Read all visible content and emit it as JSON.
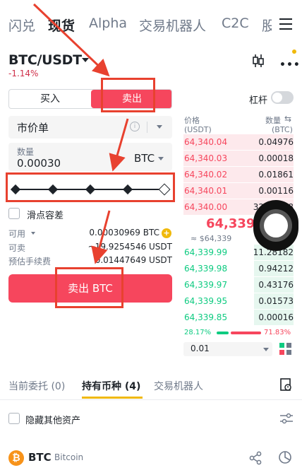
{
  "top_tabs": [
    {
      "label": "闪兑"
    },
    {
      "label": "现货"
    },
    {
      "label": "Alpha"
    },
    {
      "label": "交易机器人"
    },
    {
      "label": "C2C"
    },
    {
      "label": "股"
    }
  ],
  "pair": {
    "symbol": "BTC/USDT",
    "change": "-1.14%"
  },
  "trade_side": {
    "buy": "买入",
    "sell": "卖出"
  },
  "leverage": {
    "label": "杠杆",
    "enabled": false
  },
  "order_type": {
    "label": "市价单"
  },
  "amount": {
    "label": "数量",
    "value": "0.00030",
    "unit": "BTC"
  },
  "slider": {
    "percent": 100
  },
  "slippage": {
    "label": "滑点容差",
    "checked": false
  },
  "info": {
    "available_label": "可用",
    "available_value": "0.00030969 BTC",
    "sellable_label": "可卖",
    "sellable_value": "~19.9254546 USDT",
    "fee_label": "预估手续费",
    "fee_value": "0.01447649 USDT"
  },
  "sell_button": {
    "label": "卖出 BTC"
  },
  "order_book": {
    "price_header": "价格",
    "price_unit": "(USDT)",
    "qty_header": "数量",
    "qty_unit": "(BTC)",
    "asks": [
      {
        "price": "64,340.04",
        "qty": "0.04976"
      },
      {
        "price": "64,340.03",
        "qty": "0.00018"
      },
      {
        "price": "64,340.02",
        "qty": "0.01861"
      },
      {
        "price": "64,340.01",
        "qty": "0.00116"
      },
      {
        "price": "64,340.00",
        "qty": "32.00418"
      }
    ],
    "last_price": "64,339",
    "last_usd": "≈ $64,339",
    "bids": [
      {
        "price": "64,339.99",
        "qty": "11.28182"
      },
      {
        "price": "64,339.98",
        "qty": "0.94212"
      },
      {
        "price": "64,339.97",
        "qty": "0.43176"
      },
      {
        "price": "64,339.95",
        "qty": "0.01573"
      },
      {
        "price": "64,339.85",
        "qty": "0.00016"
      }
    ],
    "buy_ratio": "28.17%",
    "sell_ratio": "71.83%",
    "precision": "0.01"
  },
  "bottom_tabs": [
    {
      "label": "当前委托 (0)"
    },
    {
      "label": "持有币种 (4)"
    },
    {
      "label": "交易机器人"
    }
  ],
  "hide_assets": {
    "label": "隐藏其他资产",
    "checked": false
  },
  "asset": {
    "symbol": "BTC",
    "name": "Bitcoin",
    "icon_glyph": "₿"
  },
  "colors": {
    "sell": "#f6465d",
    "buy": "#0ecb81",
    "accent": "#f0b90b",
    "annotation": "#e8412f"
  },
  "icons": [
    "chart-icon",
    "more-icon",
    "menu-icon",
    "info-icon",
    "plus-icon",
    "layout-icon",
    "orders-icon",
    "filter-icon",
    "share-icon",
    "pie-icon"
  ]
}
